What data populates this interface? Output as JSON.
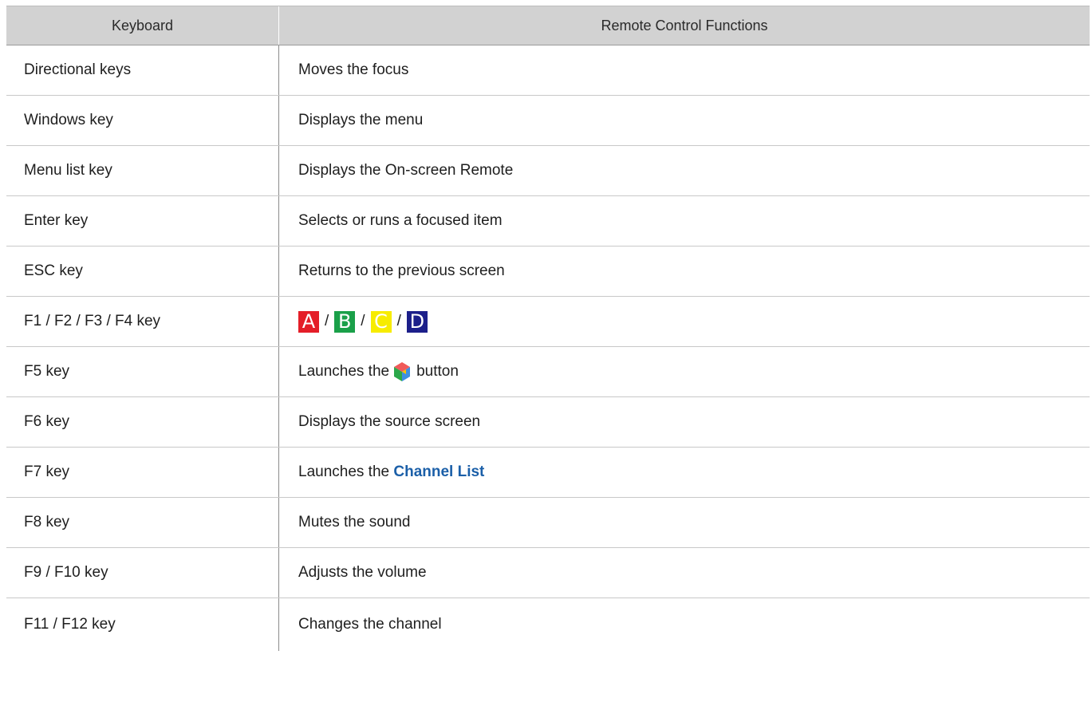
{
  "header": {
    "keyboard": "Keyboard",
    "functions": "Remote Control Functions"
  },
  "rows": [
    {
      "key": "Directional keys",
      "func": "Moves the focus"
    },
    {
      "key": "Windows key",
      "func": "Displays the menu"
    },
    {
      "key": "Menu list key",
      "func": "Displays the On-screen Remote"
    },
    {
      "key": "Enter key",
      "func": "Selects or runs a focused item"
    },
    {
      "key": "ESC key",
      "func": "Returns to the previous screen"
    },
    {
      "key": "F1 / F2 / F3 / F4 key",
      "color_buttons": [
        {
          "label": "A",
          "color": "#e41e28"
        },
        {
          "label": "B",
          "color": "#1aa049"
        },
        {
          "label": "C",
          "color": "#f7ec00"
        },
        {
          "label": "D",
          "color": "#1c1f8a"
        }
      ],
      "separator": "/"
    },
    {
      "key": "F5 key",
      "func_before": "Launches the",
      "icon": "smart-hub-icon",
      "func_after": "button"
    },
    {
      "key": "F6 key",
      "func": "Displays the source screen"
    },
    {
      "key": "F7 key",
      "func_before": "Launches the",
      "func_link": "Channel List"
    },
    {
      "key": "F8 key",
      "func": "Mutes the sound"
    },
    {
      "key": "F9 / F10 key",
      "func": "Adjusts the volume"
    },
    {
      "key": "F11 / F12 key",
      "func": "Changes the channel"
    }
  ],
  "colors": {
    "header_bg": "#d2d2d2",
    "link": "#1b5fa8"
  }
}
